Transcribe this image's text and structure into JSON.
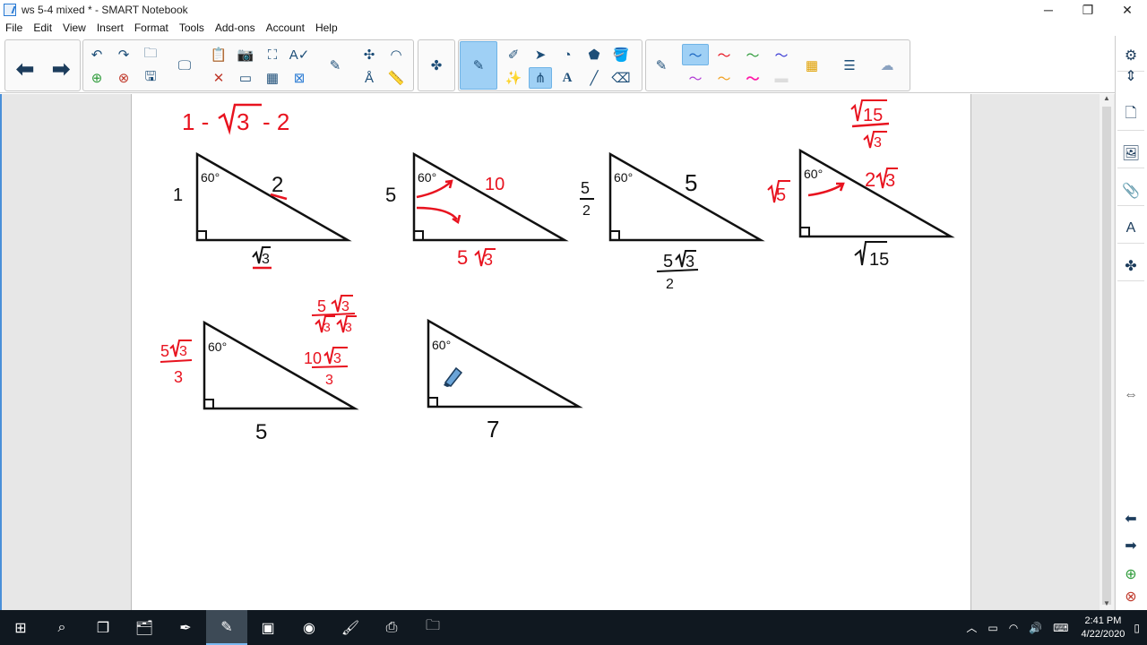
{
  "window": {
    "title": "ws 5-4 mixed * - SMART Notebook",
    "minimize": "─",
    "restore": "❐",
    "close": "✕"
  },
  "menu": [
    "File",
    "Edit",
    "View",
    "Insert",
    "Format",
    "Tools",
    "Add-ons",
    "Account",
    "Help"
  ],
  "toolbar": {
    "back_icon": "arrow-left",
    "forward_icon": "arrow-right",
    "active_tool": "pen",
    "accent": "#9fd0f5"
  },
  "sidetabs": [
    "page-sorter",
    "gallery",
    "attachments",
    "properties",
    "add-ons"
  ],
  "page": {
    "header_expr": {
      "a": "1 -",
      "b": "3",
      "c": "- 2"
    },
    "triangles": [
      {
        "angle": "60°",
        "left": "1",
        "hyp": "2",
        "base": "3"
      },
      {
        "angle": "60°",
        "left": "5",
        "hyp": "10",
        "base": "5",
        "base_rad": "3"
      },
      {
        "angle": "60°",
        "left_num": "5",
        "left_den": "2",
        "hyp": "5",
        "base_num": "5",
        "base_rad": "3",
        "base_den": "2"
      },
      {
        "angle": "60°",
        "left_rad": "5",
        "hyp_coef": "2",
        "hyp_rad": "3",
        "base_rad": "15",
        "top_num_rad": "15",
        "top_den_rad": "3"
      },
      {
        "angle": "60°",
        "left_num": "5",
        "left_rad": "3",
        "left_den": "3",
        "hyp_num": "10",
        "hyp_rad": "3",
        "hyp_den": "3",
        "base": "5",
        "work_num": "5",
        "work_rad": "3",
        "work_den_a": "3",
        "work_den_b": "3"
      },
      {
        "angle": "60°",
        "base": "7"
      }
    ]
  },
  "taskbar": {
    "time": "2:41 PM",
    "date": "4/22/2020"
  },
  "colors": {
    "ink_red": "#e8131f",
    "ink_black": "#111111",
    "taskbar": "#101820"
  }
}
